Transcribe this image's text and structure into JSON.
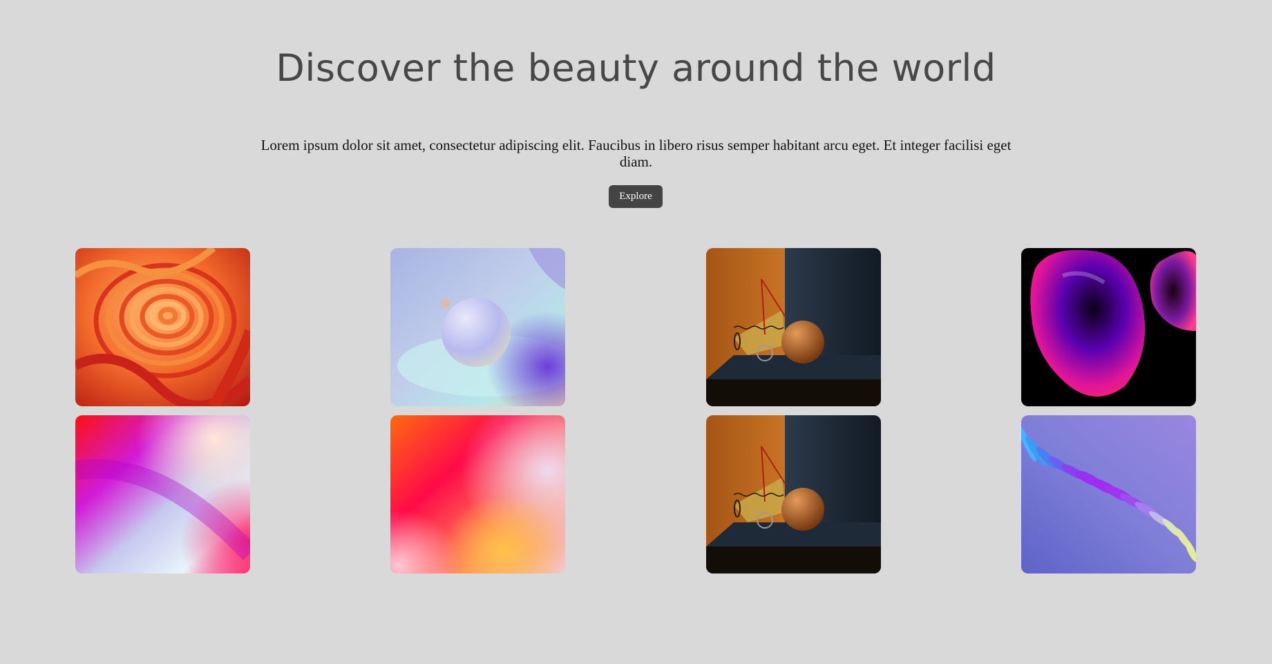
{
  "hero": {
    "title": "Discover the beauty around the world",
    "description": "Lorem ipsum dolor sit amet, consectetur adipiscing elit. Faucibus in libero risus semper habitant arcu eget. Et integer facilisi eget diam.",
    "button_label": "Explore"
  },
  "colors": {
    "background": "#d9d9d9",
    "title": "#474747",
    "button": "#444444",
    "button_text": "#ffffff"
  },
  "gallery": {
    "images": [
      {
        "name": "orange-red-swirl-artwork"
      },
      {
        "name": "pastel-sphere-artwork"
      },
      {
        "name": "orange-room-sphere-artwork"
      },
      {
        "name": "magenta-blob-artwork"
      },
      {
        "name": "red-purple-gradient-artwork"
      },
      {
        "name": "red-orange-gradient-artwork"
      },
      {
        "name": "orange-room-sphere-artwork"
      },
      {
        "name": "purple-wave-artwork"
      }
    ]
  }
}
